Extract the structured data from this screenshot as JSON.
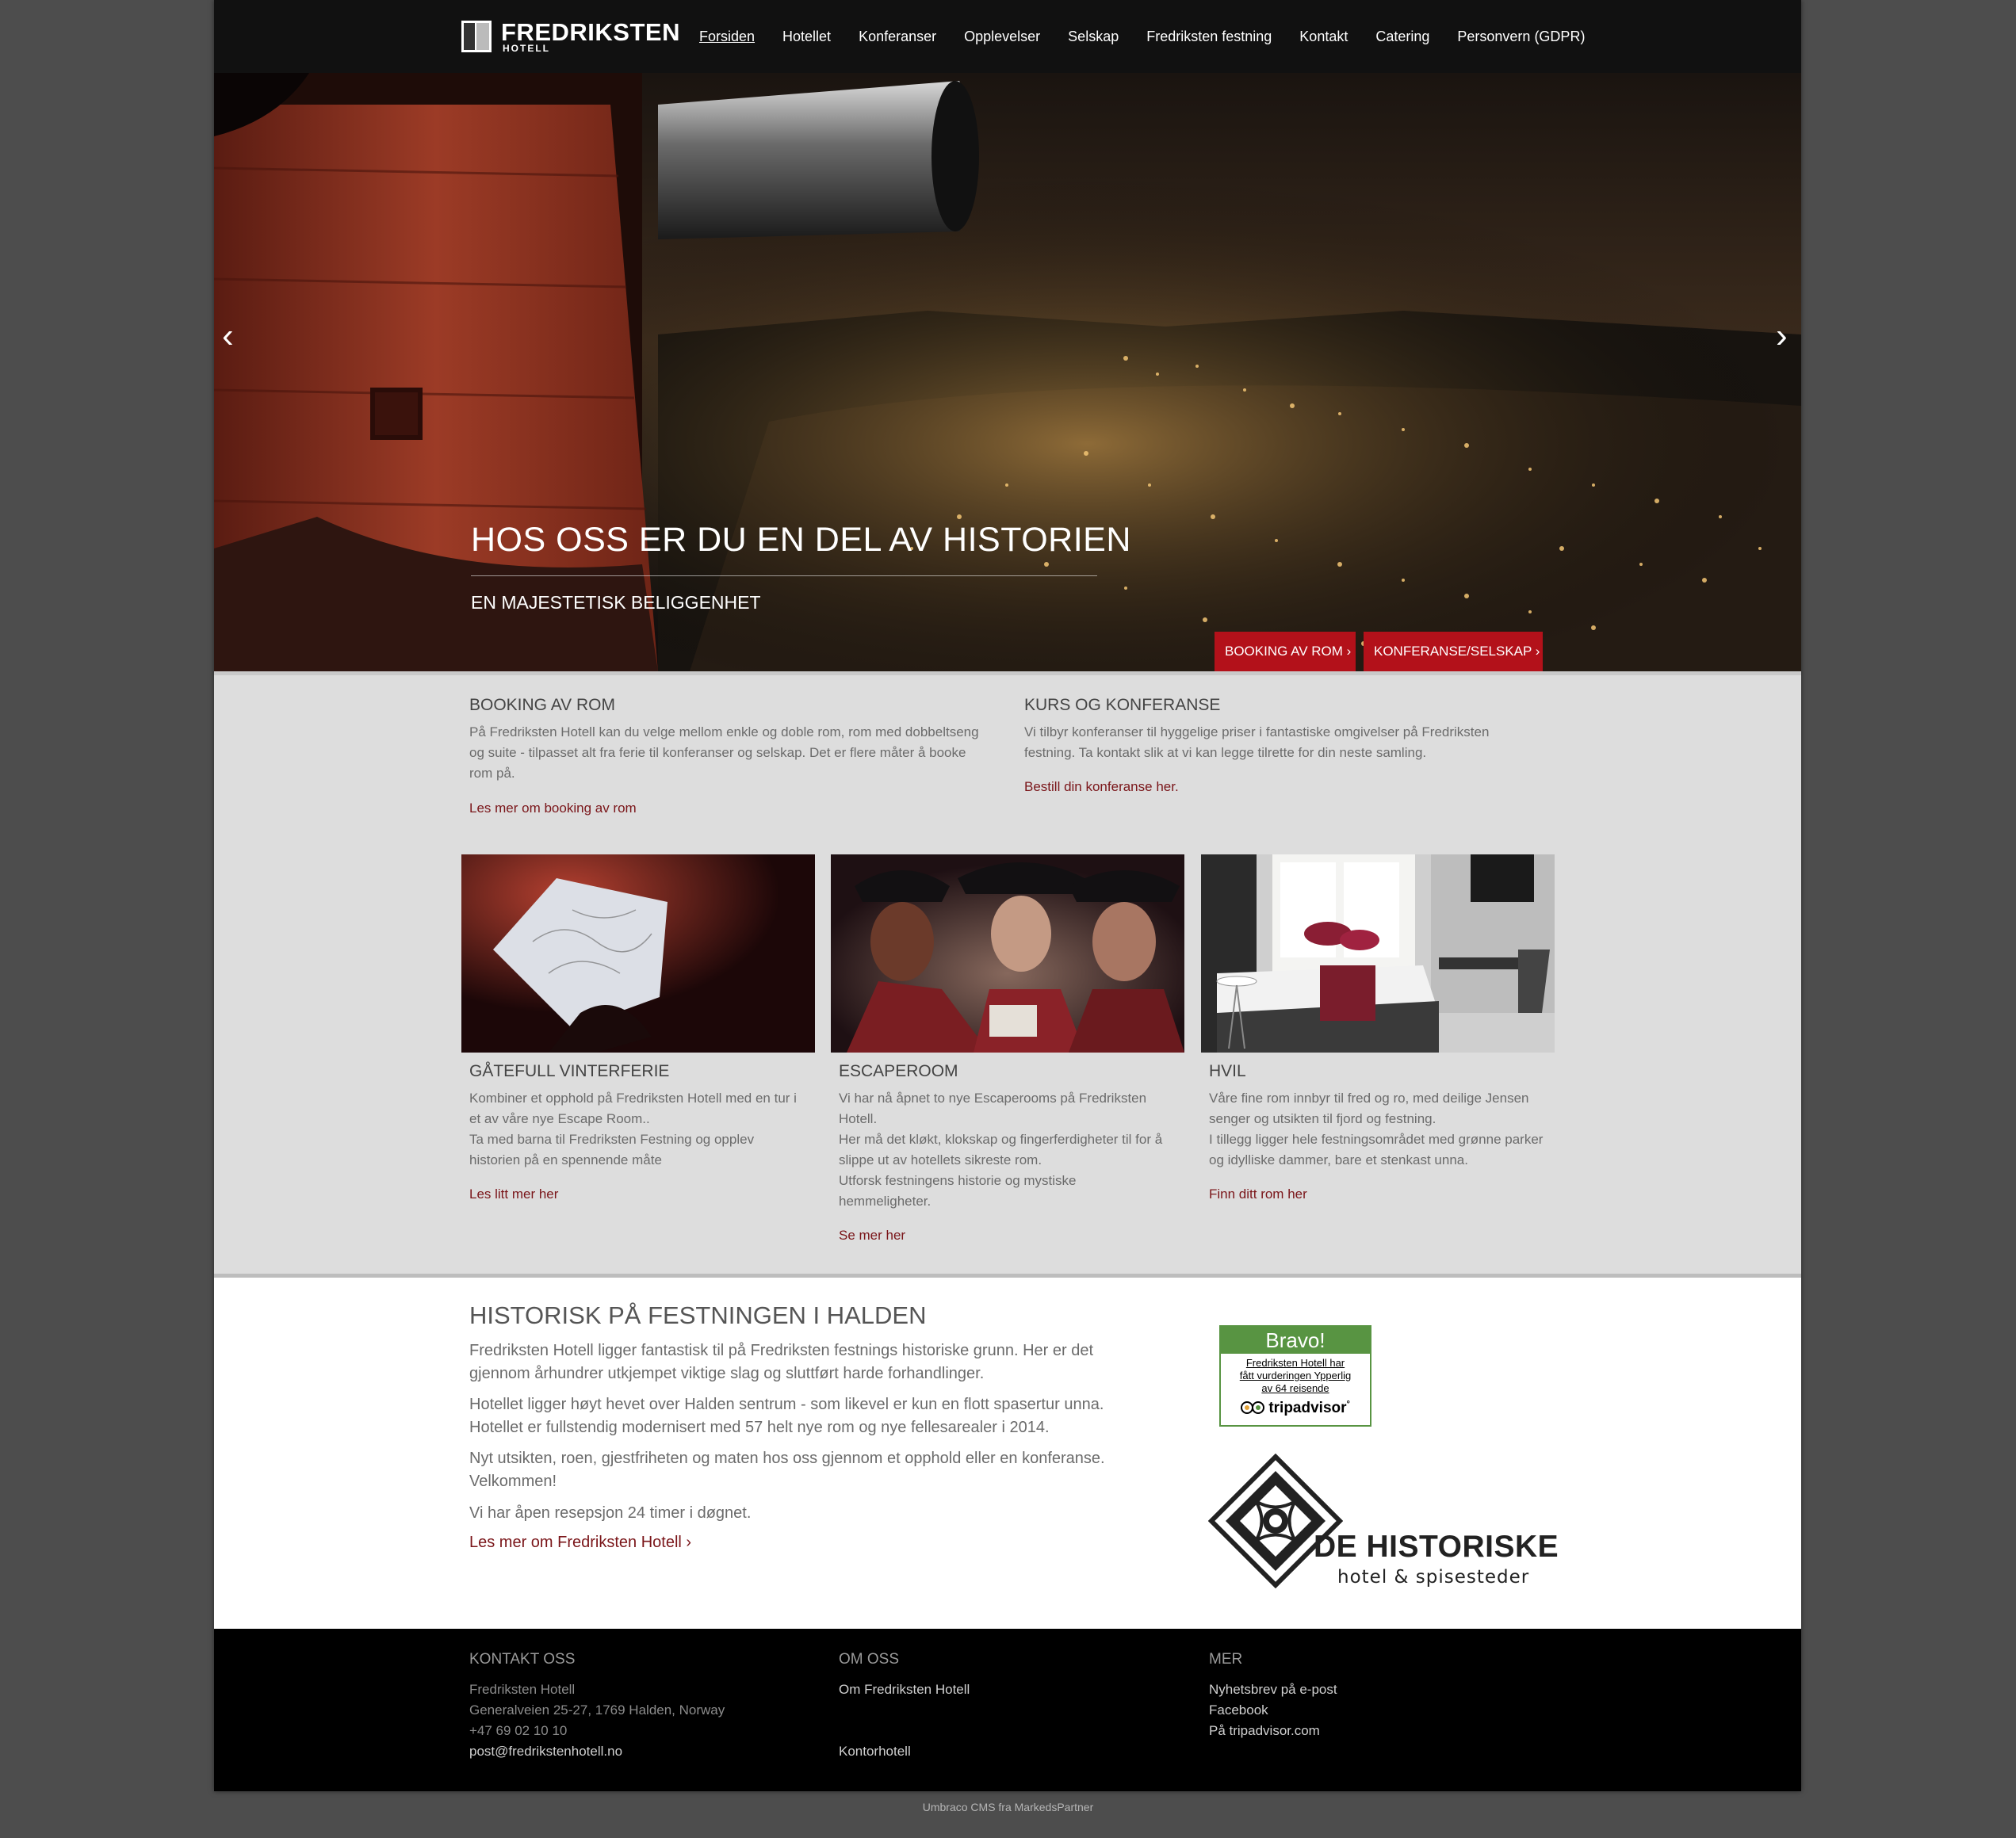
{
  "header": {
    "logo_name": "FREDRIKSTEN",
    "logo_sub": "HOTELL",
    "nav": [
      "Forsiden",
      "Hotellet",
      "Konferanser",
      "Opplevelser",
      "Selskap",
      "Fredriksten festning",
      "Kontakt",
      "Catering",
      "Personvern (GDPR)"
    ],
    "active_nav": "Forsiden"
  },
  "hero": {
    "title": "HOS OSS ER DU EN DEL AV HISTORIEN",
    "subtitle": "EN MAJESTETISK BELIGGENHET",
    "prev_icon": "chevron-left-icon",
    "next_icon": "chevron-right-icon",
    "prev_glyph": "‹",
    "next_glyph": "›",
    "buttons": [
      "BOOKING AV ROM ›",
      "KONFERANSE/SELSKAP ›"
    ]
  },
  "intro": {
    "booking": {
      "title": "BOOKING AV ROM",
      "text_lines": [
        "På Fredriksten Hotell kan du velge mellom enkle og doble rom, rom med dobbeltseng",
        "og suite - tilpasset alt fra ferie til konferanser og selskap. Det er flere måter å booke",
        "rom på."
      ],
      "link": "Les mer om booking av rom"
    },
    "conference": {
      "title": "KURS OG KONFERANSE",
      "text_lines": [
        "Vi tilbyr konferanser til hyggelige priser i fantastiske omgivelser på Fredriksten",
        "festning. Ta kontakt slik at vi kan legge tilrette for din neste samling."
      ],
      "link": "Bestill din konferanse her."
    }
  },
  "cards": [
    {
      "title": "GÅTEFULL VINTERFERIE",
      "text_lines": [
        "Kombiner et opphold på Fredriksten Hotell med en tur i",
        "et av våre nye Escape Room..",
        "Ta med barna til Fredriksten Festning og opplev",
        "historien på en spennende måte"
      ],
      "link": "Les litt mer her"
    },
    {
      "title": "ESCAPEROOM",
      "text_lines": [
        "Vi har nå åpnet to nye Escaperooms på Fredriksten",
        "Hotell.",
        "Her må det kløkt, klokskap og fingerferdigheter til for å",
        "slippe ut av hotellets sikreste rom.",
        "Utforsk festningens historie og mystiske",
        "hemmeligheter."
      ],
      "link": "Se mer her"
    },
    {
      "title": "HVIL",
      "text_lines": [
        "Våre fine rom innbyr til fred og ro, med deilige Jensen",
        "senger og utsikten til fjord og festning.",
        "I tillegg ligger hele festningsområdet med grønne parker",
        "og idylliske dammer, bare et stenkast unna."
      ],
      "link": "Finn ditt rom her"
    }
  ],
  "about": {
    "title": "HISTORISK PÅ FESTNINGEN I HALDEN",
    "paragraphs": [
      [
        "Fredriksten Hotell ligger fantastisk til på Fredriksten festnings historiske grunn. Her er det",
        "gjennom århundrer utkjempet viktige slag og sluttført harde forhandlinger."
      ],
      [
        "Hotellet ligger høyt hevet over Halden sentrum - som likevel er kun en flott spasertur unna.",
        "Hotellet er fullstendig modernisert med 57 helt nye rom og nye fellesarealer i 2014."
      ],
      [
        "Nyt utsikten, roen, gjestfriheten og maten hos oss gjennom et opphold eller en konferanse.",
        "Velkommen!"
      ],
      [
        "Vi har åpen resepsjon 24 timer i døgnet."
      ]
    ],
    "link": "Les mer om Fredriksten Hotell ›"
  },
  "tripadvisor": {
    "heading": "Bravo!",
    "text_lines": [
      "Fredriksten Hotell har",
      "fått vurderingen Ypperlig",
      "av 64 reisende"
    ],
    "logo_text": "tripadvisor",
    "logo_dot": "°",
    "color": "#589442"
  },
  "historiske": {
    "name": "DE HISTORISKE",
    "sub": "hotel & spisesteder"
  },
  "footer": {
    "contact": {
      "title": "KONTAKT OSS",
      "name": "Fredriksten Hotell",
      "address": "Generalveien 25-27, 1769 Halden, Norway",
      "phone": "+47 69 02 10 10",
      "email": "post@fredrikstenhotell.no"
    },
    "about": {
      "title": "OM OSS",
      "links": [
        "Om Fredriksten Hotell",
        "Kontorhotell"
      ]
    },
    "more": {
      "title": "MER",
      "links": [
        "Nyhetsbrev på e-post",
        "Facebook",
        "På tripadvisor.com"
      ]
    }
  },
  "credit": "Umbraco CMS fra MarkedsPartner",
  "colors": {
    "accent": "#b3111a",
    "link": "#7a1519",
    "header_bg": "#111111",
    "footer_bg": "#000000"
  }
}
